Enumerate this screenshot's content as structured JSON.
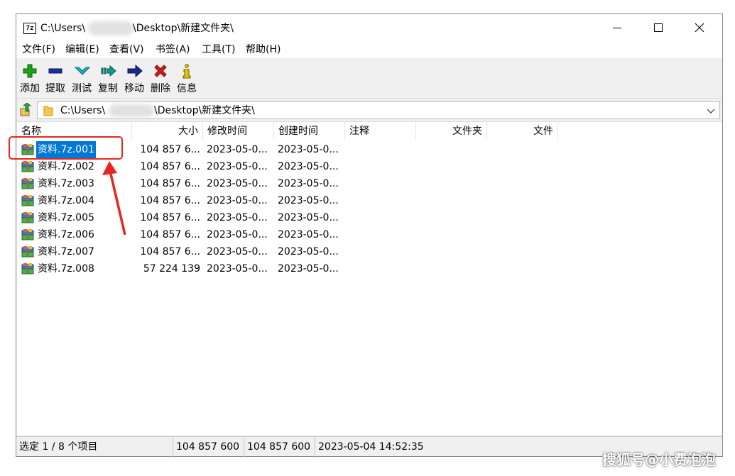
{
  "window": {
    "title_prefix": "C:\\Users\\",
    "title_suffix": "\\Desktop\\新建文件夹\\",
    "app_icon_label": "7z",
    "controls": [
      "minimize-icon",
      "maximize-icon",
      "close-icon"
    ]
  },
  "menu": [
    {
      "label": "文件(F)"
    },
    {
      "label": "编辑(E)"
    },
    {
      "label": "查看(V)"
    },
    {
      "label": "书签(A)"
    },
    {
      "label": "工具(T)"
    },
    {
      "label": "帮助(H)"
    }
  ],
  "toolbar": [
    {
      "label": "添加",
      "icon": "add-icon",
      "color": "#1aa31a"
    },
    {
      "label": "提取",
      "icon": "extract-icon",
      "color": "#1d2f9c"
    },
    {
      "label": "测试",
      "icon": "test-icon",
      "color": "#13a6a6"
    },
    {
      "label": "复制",
      "icon": "copy-icon",
      "color": "#129a8a"
    },
    {
      "label": "移动",
      "icon": "move-icon",
      "color": "#1b2a8f"
    },
    {
      "label": "删除",
      "icon": "delete-icon",
      "color": "#d01b1b"
    },
    {
      "label": "信息",
      "icon": "info-icon",
      "color": "#d9b600"
    }
  ],
  "address": {
    "prefix": "C:\\Users\\",
    "suffix": "\\Desktop\\新建文件夹\\"
  },
  "columns": [
    {
      "label": "名称"
    },
    {
      "label": "大小"
    },
    {
      "label": "修改时间"
    },
    {
      "label": "创建时间"
    },
    {
      "label": "注释"
    },
    {
      "label": "文件夹"
    },
    {
      "label": "文件"
    }
  ],
  "files": [
    {
      "name": "资料.7z.001",
      "size": "104 857 6...",
      "modified": "2023-05-0...",
      "created": "2023-05-0...",
      "selected": true
    },
    {
      "name": "资料.7z.002",
      "size": "104 857 6...",
      "modified": "2023-05-0...",
      "created": "2023-05-0...",
      "selected": false
    },
    {
      "name": "资料.7z.003",
      "size": "104 857 6...",
      "modified": "2023-05-0...",
      "created": "2023-05-0...",
      "selected": false
    },
    {
      "name": "资料.7z.004",
      "size": "104 857 6...",
      "modified": "2023-05-0...",
      "created": "2023-05-0...",
      "selected": false
    },
    {
      "name": "资料.7z.005",
      "size": "104 857 6...",
      "modified": "2023-05-0...",
      "created": "2023-05-0...",
      "selected": false
    },
    {
      "name": "资料.7z.006",
      "size": "104 857 6...",
      "modified": "2023-05-0...",
      "created": "2023-05-0...",
      "selected": false
    },
    {
      "name": "资料.7z.007",
      "size": "104 857 6...",
      "modified": "2023-05-0...",
      "created": "2023-05-0...",
      "selected": false
    },
    {
      "name": "资料.7z.008",
      "size": "57 224 139",
      "modified": "2023-05-0...",
      "created": "2023-05-0...",
      "selected": false
    }
  ],
  "status": {
    "selection": "选定 1 / 8 个项目",
    "size": "104 857 600",
    "packed_size": "104 857 600",
    "datetime": "2023-05-04 14:52:35"
  },
  "colors": {
    "selection": "#0078d7",
    "annotation": "#e8261d"
  },
  "watermark": "搜狐号@小费泡泡"
}
